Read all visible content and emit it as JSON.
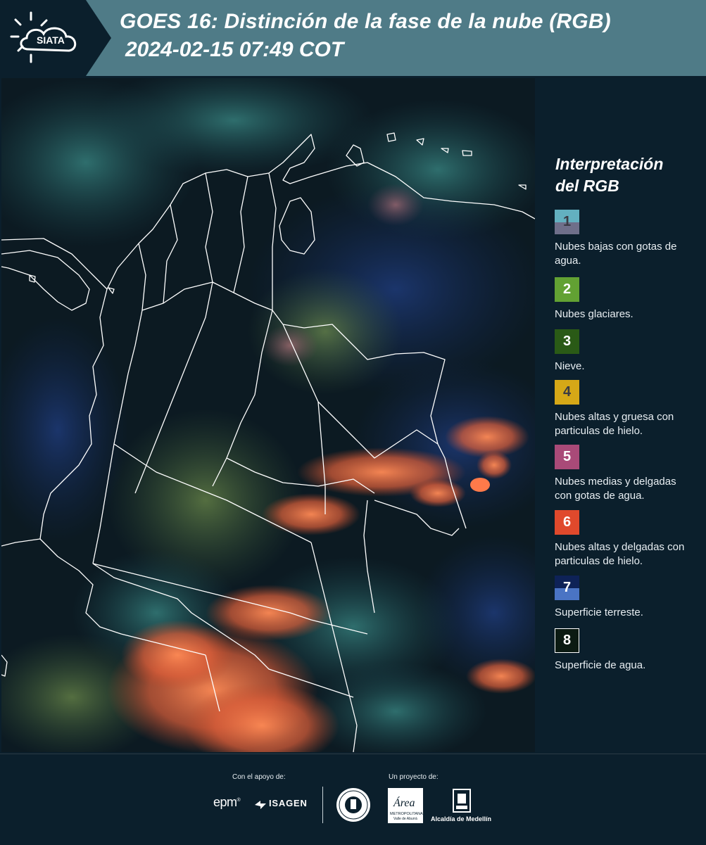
{
  "header": {
    "logo_text": "SIATA",
    "title": "GOES 16: Distinción de la fase de la nube (RGB)",
    "datetime": "2024-02-15 07:49 COT",
    "background": "#4f7b87"
  },
  "legend": {
    "title_line1": "Interpretación",
    "title_line2": "del RGB",
    "items": [
      {
        "number": "1",
        "label": "Nubes bajas con gotas de agua.",
        "color_top": "#63b0c0",
        "color_bottom": "#6f6f8a"
      },
      {
        "number": "2",
        "label": "Nubes glaciares.",
        "color_top": "#62a133",
        "color_bottom": "#62a133"
      },
      {
        "number": "3",
        "label": "Nieve.",
        "color_top": "#2a5a16",
        "color_bottom": "#2a5a16"
      },
      {
        "number": "4",
        "label": "Nubes altas y gruesa con particulas de hielo.",
        "color_top": "#d6a817",
        "color_bottom": "#d6a817"
      },
      {
        "number": "5",
        "label": "Nubes medias y delgadas con gotas de agua.",
        "color_top": "#a94a78",
        "color_bottom": "#a94a78"
      },
      {
        "number": "6",
        "label": "Nubes altas y delgadas con particulas de hielo.",
        "color_top": "#e0492c",
        "color_bottom": "#e0492c"
      },
      {
        "number": "7",
        "label": "Superficie terreste.",
        "color_top": "#0e2257",
        "color_bottom": "#4a74c4"
      },
      {
        "number": "8",
        "label": "Superficie de agua.",
        "color_top": "#0b1a12",
        "color_bottom": "#0b1a12"
      }
    ]
  },
  "footer": {
    "support_label": "Con el apoyo de:",
    "project_label": "Un proyecto de:",
    "epm": "epm",
    "isagen": "ISAGEN",
    "area_logo_text": "Área",
    "area_sub": "METROPOLITANA",
    "area_sub2": "Valle de Aburrá",
    "alcaldia": "Alcaldía de Medellín"
  }
}
